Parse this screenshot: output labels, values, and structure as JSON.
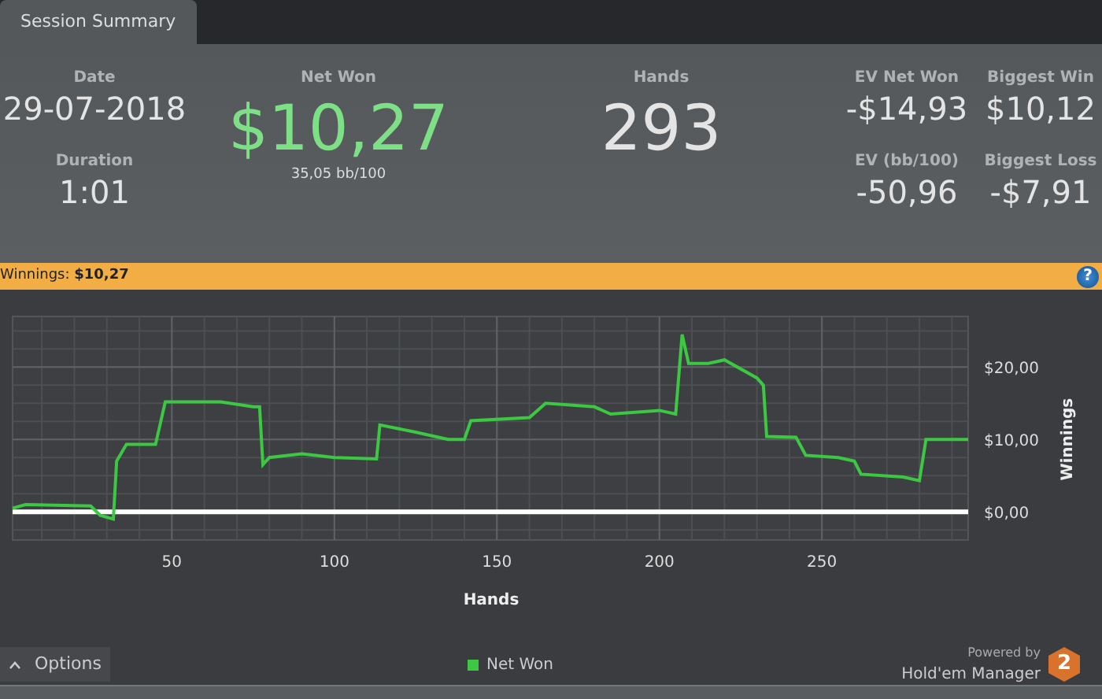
{
  "tabs": [
    {
      "label": "Session Summary",
      "selected": true
    }
  ],
  "summary": {
    "stats": [
      {
        "label": "Date",
        "value": "29-07-2018",
        "kind": "medium"
      },
      {
        "label": "Duration",
        "value": "1:01",
        "kind": "medium"
      },
      {
        "label": "Net Won",
        "value": "$10,27",
        "kind": "hero",
        "positive": true,
        "sub": "35,05 bb/100"
      },
      {
        "label": "Hands",
        "value": "293",
        "kind": "hero",
        "positive": false
      },
      {
        "label": "EV Net Won",
        "value": "-$14,93",
        "kind": "medium"
      },
      {
        "label": "EV (bb/100)",
        "value": "-50,96",
        "kind": "medium"
      },
      {
        "label": "Biggest Win",
        "value": "$10,12",
        "kind": "medium"
      },
      {
        "label": "Biggest Loss",
        "value": "-$7,91",
        "kind": "medium"
      }
    ]
  },
  "winnings_bar": {
    "label": "Winnings:",
    "value": "$10,27",
    "help": "?"
  },
  "chart": {
    "chart_data": {
      "type": "line",
      "xlabel": "Hands",
      "ylabel": "Winnings",
      "xlim": [
        1,
        295
      ],
      "ylim": [
        -3.9,
        27
      ],
      "xticks": [
        50,
        100,
        150,
        200,
        250
      ],
      "grid": true,
      "yticks": [
        {
          "value": 0,
          "label": "$0,00"
        },
        {
          "value": 10,
          "label": "$10,00"
        },
        {
          "value": 20,
          "label": "$20,00"
        }
      ],
      "x": [
        1,
        5,
        25,
        28,
        32,
        33,
        36,
        45,
        48,
        65,
        75,
        77,
        78,
        80,
        90,
        100,
        113,
        114,
        125,
        135,
        140,
        142,
        160,
        165,
        180,
        185,
        200,
        205,
        207,
        209,
        215,
        220,
        230,
        232,
        233,
        242,
        245,
        255,
        260,
        262,
        275,
        280,
        282,
        295
      ],
      "series": [
        {
          "name": "Net Won",
          "color": "#3cc843",
          "values": [
            0.5,
            1,
            0.8,
            -0.5,
            -1,
            7,
            9.3,
            9.3,
            15.2,
            15.2,
            14.5,
            14.5,
            6.5,
            7.5,
            8,
            7.5,
            7.3,
            12,
            11,
            10,
            10,
            12.6,
            13,
            15,
            14.5,
            13.5,
            14,
            13.5,
            24.5,
            20.5,
            20.5,
            21,
            18.5,
            17.5,
            10.4,
            10.3,
            7.8,
            7.5,
            7,
            5.2,
            4.8,
            4.3,
            10,
            10
          ]
        }
      ]
    }
  },
  "footer": {
    "options_button": "Options",
    "powered_by": "Powered by",
    "brand": "Hold'em Manager",
    "brand_badge": "2"
  }
}
